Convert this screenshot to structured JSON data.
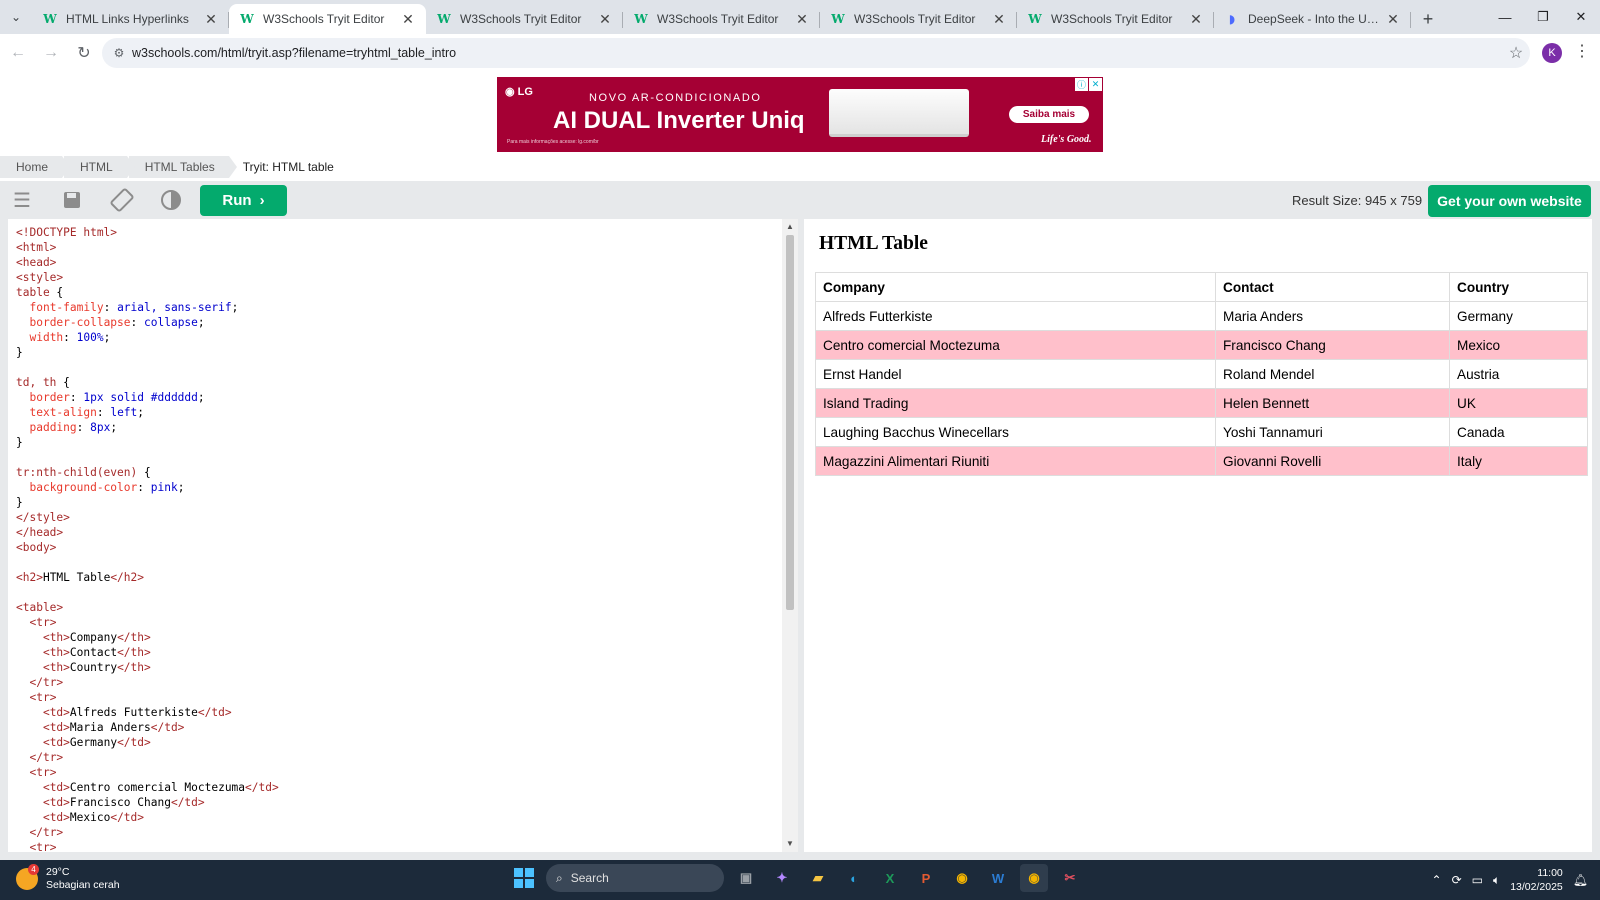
{
  "browser": {
    "tabs": [
      {
        "title": "HTML Links Hyperlinks",
        "favicon": "w3schools-icon",
        "active": false
      },
      {
        "title": "W3Schools Tryit Editor",
        "favicon": "w3schools-icon",
        "active": true
      },
      {
        "title": "W3Schools Tryit Editor",
        "favicon": "w3schools-icon",
        "active": false
      },
      {
        "title": "W3Schools Tryit Editor",
        "favicon": "w3schools-icon",
        "active": false
      },
      {
        "title": "W3Schools Tryit Editor",
        "favicon": "w3schools-icon",
        "active": false
      },
      {
        "title": "W3Schools Tryit Editor",
        "favicon": "w3schools-icon",
        "active": false
      },
      {
        "title": "DeepSeek - Into the Unknown",
        "favicon": "deepseek-icon",
        "active": false
      }
    ],
    "url": "w3schools.com/html/tryit.asp?filename=tryhtml_table_intro",
    "profile_initial": "K"
  },
  "ad": {
    "brand": "LG",
    "kicker": "NOVO AR-CONDICIONADO",
    "title": "AI DUAL Inverter Uniq",
    "fine_print": "Para mais informações acesse: lg.com/br",
    "cta": "Saiba mais",
    "tagline": "Life's Good.",
    "brand_color": "#a50034"
  },
  "breadcrumb": [
    "Home",
    "HTML",
    "HTML Tables",
    "Tryit: HTML table"
  ],
  "toolbar": {
    "run_label": "Run",
    "result_size": "Result Size: 945 x 759",
    "get_website": "Get your own website",
    "accent": "#04aa6d"
  },
  "result": {
    "heading": "HTML Table",
    "headers": [
      "Company",
      "Contact",
      "Country"
    ],
    "rows": [
      [
        "Alfreds Futterkiste",
        "Maria Anders",
        "Germany"
      ],
      [
        "Centro comercial Moctezuma",
        "Francisco Chang",
        "Mexico"
      ],
      [
        "Ernst Handel",
        "Roland Mendel",
        "Austria"
      ],
      [
        "Island Trading",
        "Helen Bennett",
        "UK"
      ],
      [
        "Laughing Bacchus Winecellars",
        "Yoshi Tannamuri",
        "Canada"
      ],
      [
        "Magazzini Alimentari Riuniti",
        "Giovanni Rovelli",
        "Italy"
      ]
    ]
  },
  "code_lines": [
    "<!DOCTYPE html>",
    "<html>",
    "<head>",
    "<style>",
    "table {",
    "  font-family: arial, sans-serif;",
    "  border-collapse: collapse;",
    "  width: 100%;",
    "}",
    "",
    "td, th {",
    "  border: 1px solid #dddddd;",
    "  text-align: left;",
    "  padding: 8px;",
    "}",
    "",
    "tr:nth-child(even) {",
    "  background-color: pink;",
    "}",
    "</style>",
    "</head>",
    "<body>",
    "",
    "<h2>HTML Table</h2>",
    "",
    "<table>",
    "  <tr>",
    "    <th>Company</th>",
    "    <th>Contact</th>",
    "    <th>Country</th>",
    "  </tr>",
    "  <tr>",
    "    <td>Alfreds Futterkiste</td>",
    "    <td>Maria Anders</td>",
    "    <td>Germany</td>",
    "  </tr>",
    "  <tr>",
    "    <td>Centro comercial Moctezuma</td>",
    "    <td>Francisco Chang</td>",
    "    <td>Mexico</td>",
    "  </tr>",
    "  <tr>"
  ],
  "taskbar": {
    "weather_badge": "4",
    "temperature": "29°C",
    "condition": "Sebagian cerah",
    "search_placeholder": "Search",
    "time": "11:00",
    "date": "13/02/2025"
  }
}
